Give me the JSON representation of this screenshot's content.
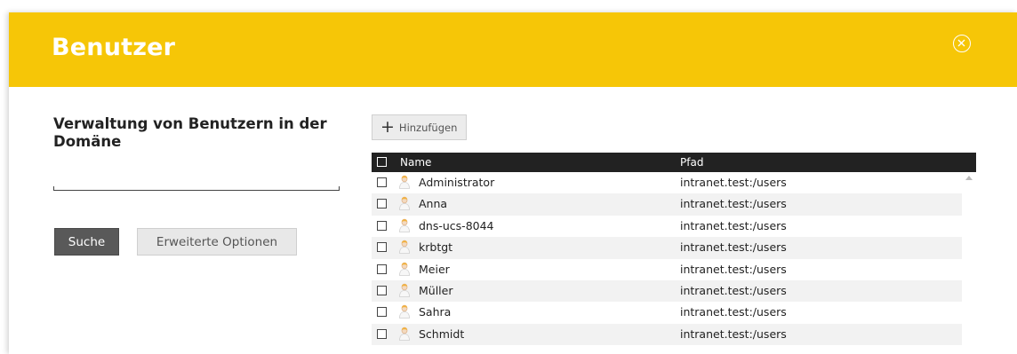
{
  "header": {
    "title": "Benutzer",
    "close_icon": "close-circle-icon"
  },
  "left": {
    "description": "Verwaltung von Benutzern in der Domäne",
    "search_value": "",
    "search_button": "Suche",
    "advanced_button": "Erweiterte Optionen"
  },
  "toolbar": {
    "add_label": "Hinzufügen",
    "add_icon": "plus-icon"
  },
  "grid": {
    "columns": [
      "Name",
      "Pfad"
    ],
    "rows": [
      {
        "name": "Administrator",
        "path": "intranet.test:/users"
      },
      {
        "name": "Anna",
        "path": "intranet.test:/users"
      },
      {
        "name": "dns-ucs-8044",
        "path": "intranet.test:/users"
      },
      {
        "name": "krbtgt",
        "path": "intranet.test:/users"
      },
      {
        "name": "Meier",
        "path": "intranet.test:/users"
      },
      {
        "name": "Müller",
        "path": "intranet.test:/users"
      },
      {
        "name": "Sahra",
        "path": "intranet.test:/users"
      },
      {
        "name": "Schmidt",
        "path": "intranet.test:/users"
      }
    ]
  },
  "colors": {
    "header_bg": "#f6c607",
    "grid_header_bg": "#222222",
    "primary_button": "#595959"
  }
}
